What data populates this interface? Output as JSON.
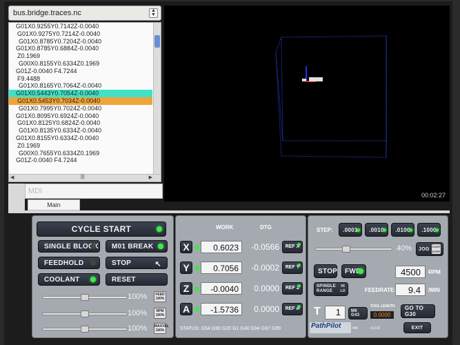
{
  "file": {
    "name": "bus.bridge.traces.nc"
  },
  "gcode": {
    "lines": [
      "G01X0.9255Y0.7142Z-0.0040",
      "G01X0.9275Y0.7214Z-0.0040",
      "G01X0.8785Y0.7204Z-0.0040",
      "G01X0.8785Y0.6884Z-0.0040",
      "Z0.1969",
      "G00X0.8155Y0.6334Z0.1969",
      "G01Z-0.0040 F4.7244",
      "F9.4488",
      "G01X0.8165Y0.7064Z-0.0040",
      "G01X0.5443Y0.7054Z-0.0040",
      "G01X0.5453Y0.7034Z-0.0040",
      "G01X0.7995Y0.7024Z-0.0040",
      "G01X0.8095Y0.6924Z-0.0040",
      "G01X0.8125Y0.6824Z-0.0040",
      "G01X0.8135Y0.6334Z-0.0040",
      "G01X0.8155Y0.6334Z-0.0040",
      "Z0.1969",
      "G00X0.7655Y0.6334Z0.1969",
      "G01Z-0.0040 F4.7244"
    ],
    "current_index": 9,
    "next_index": 10
  },
  "mdi": {
    "placeholder": "MDI"
  },
  "tab": {
    "main": "Main"
  },
  "viewport": {
    "timer": "00:02:27"
  },
  "controls": {
    "cycle_start": "CYCLE START",
    "single_block": "SINGLE BLOCK",
    "m01_break": "M01 BREAK",
    "feedhold": "FEEDHOLD",
    "stop": "STOP",
    "coolant": "COOLANT",
    "reset": "RESET"
  },
  "overrides": [
    {
      "percent": "100%",
      "btn": "FEED 100%",
      "level": 1.0
    },
    {
      "percent": "100%",
      "btn": "RPM 100%",
      "level": 1.0
    },
    {
      "percent": "100%",
      "btn": "MAXVEL 100%",
      "level": 1.0
    }
  ],
  "dro": {
    "work_header": "WORK",
    "dtg_header": "DTG",
    "axes": [
      {
        "axis": "X",
        "work": "0.6023",
        "dtg": "-0.0566",
        "ref": "REF X"
      },
      {
        "axis": "Y",
        "work": "0.7056",
        "dtg": "-0.0002",
        "ref": "REF Y"
      },
      {
        "axis": "Z",
        "work": "-0.0040",
        "dtg": "0.0000",
        "ref": "REF Z"
      },
      {
        "axis": "A",
        "work": "-1.5736",
        "dtg": "0.0000",
        "ref": "REF A"
      }
    ],
    "status": "STATUS: G54 G90 G20 G1 G40 G94 G97 G99"
  },
  "jog": {
    "step_label": "STEP:",
    "steps": [
      ".0001",
      ".0010",
      ".0100",
      ".1000"
    ],
    "jog_percent": "40%",
    "jog_level": 0.4,
    "jog_btn": "JOG",
    "cont_step": "CONT STEP"
  },
  "spindle": {
    "stop": "STOP",
    "fwd": "FWD",
    "rpm_value": "4500",
    "rpm_unit": "RPM",
    "range_label": "SPINDLE RANGE",
    "range_hi": "HI",
    "range_lo": "LO",
    "feedrate_label": "FEEDRATE:",
    "feedrate_value": "9.4",
    "feedrate_unit": "/MIN"
  },
  "tool": {
    "t_label": "T",
    "t_value": "1",
    "m6g43": "M6 G43",
    "tool_length_label": "TOOL LENGTH",
    "tool_length_value": "0.0000",
    "goto_g30": "GO TO G30",
    "exit": "EXIT",
    "brand": "PathPilot",
    "model": "440",
    "version": "v1.9.8"
  },
  "colors": {
    "current_line": "#41e1c6",
    "next_line": "#f0a43a",
    "led_on": "#3ee84a"
  }
}
